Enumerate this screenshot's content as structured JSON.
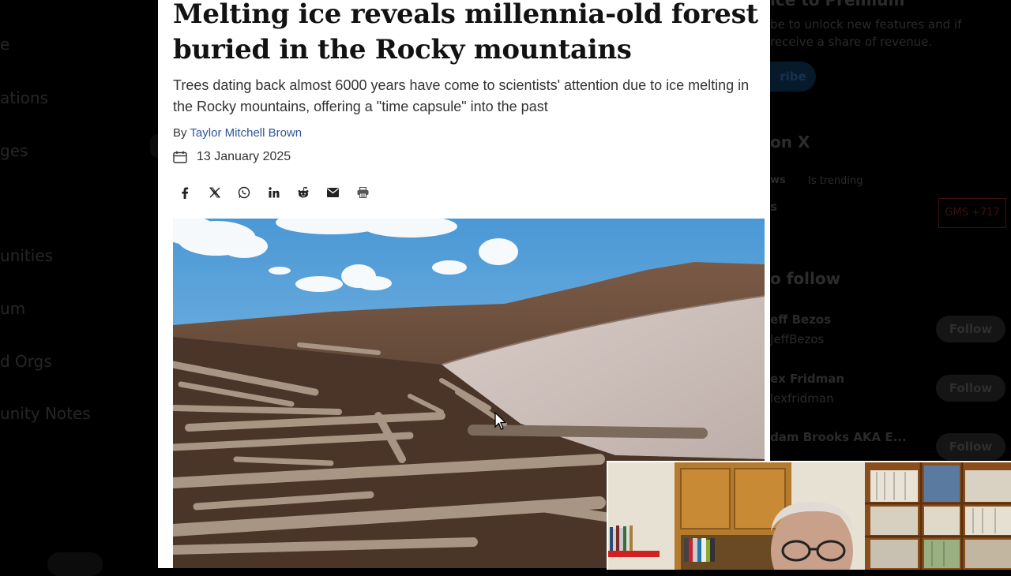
{
  "background": {
    "left_nav": [
      "e",
      "ations",
      "ges",
      "unities",
      "um",
      "d Orgs",
      "unity Notes"
    ],
    "right": {
      "premium_title": "ice to Premium",
      "premium_text": [
        "be to unlock new features and if",
        "receive a share of revenue."
      ],
      "premium_button": "ribe",
      "section_title": "on X",
      "news_label": "ws",
      "news_sub": "Is trending",
      "news_item": "s",
      "badge": "GMS +717",
      "follow_title": "o follow",
      "follow_button": "Follow",
      "who_to_follow": [
        {
          "name": "eff Bezos",
          "handle": "JeffBezos"
        },
        {
          "name": "ex Fridman",
          "handle": "lexfridman"
        },
        {
          "name": "dam Brooks AKA E...",
          "handle": ""
        }
      ]
    }
  },
  "article": {
    "headline": "Melting ice reveals millennia-old forest buried in the Rocky mountains",
    "standfirst": "Trees dating back almost 6000 years have come to scientists' attention due to ice melting in the Rocky mountains, offering a \"time capsule\" into the past",
    "byline_prefix": "By",
    "author": "Taylor Mitchell Brown",
    "date": "13 January 2025",
    "share_icons": [
      "facebook-icon",
      "x-icon",
      "whatsapp-icon",
      "linkedin-icon",
      "reddit-icon",
      "email-icon",
      "print-icon"
    ]
  },
  "colors": {
    "author_link": "#2f5597",
    "headline": "#121212",
    "body_text": "#333333"
  }
}
